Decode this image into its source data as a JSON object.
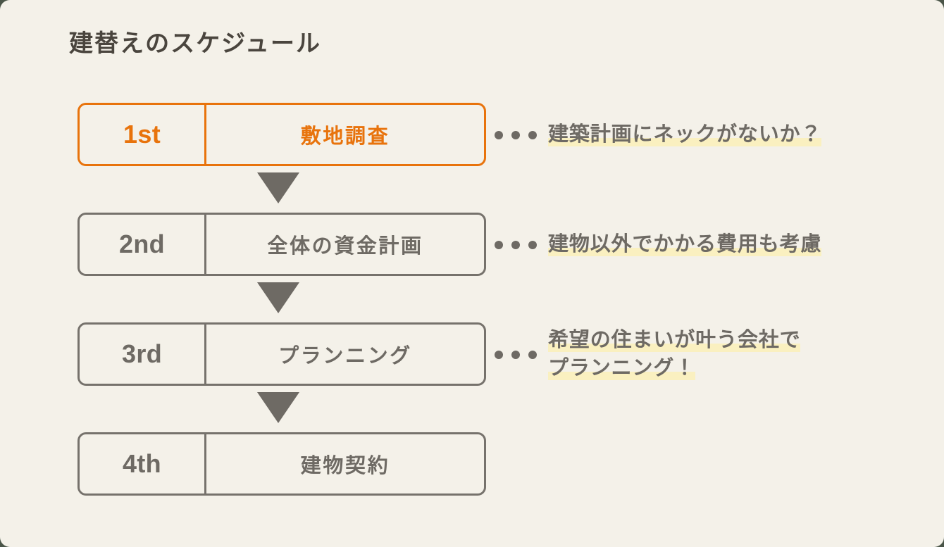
{
  "page": {
    "title": "建替えのスケジュール",
    "background_color": "#f4f1e9",
    "accent_color": "#e8730c",
    "default_color": "#6e6a64",
    "highlight_color": "#faf0c0",
    "title_color": "#4a453e"
  },
  "steps": [
    {
      "ordinal": "1st",
      "label": "敷地調査",
      "active": true,
      "note_lines": [
        "建築計画にネックがないか？"
      ]
    },
    {
      "ordinal": "2nd",
      "label": "全体の資金計画",
      "active": false,
      "note_lines": [
        "建物以外でかかる費用も考慮"
      ]
    },
    {
      "ordinal": "3rd",
      "label": "プランニング",
      "active": false,
      "note_lines": [
        "希望の住まいが叶う会社で",
        "プランニング！"
      ]
    },
    {
      "ordinal": "4th",
      "label": "建物契約",
      "active": false,
      "note_lines": []
    }
  ],
  "arrows": {
    "count": 3,
    "glyph": "triangle-down"
  }
}
